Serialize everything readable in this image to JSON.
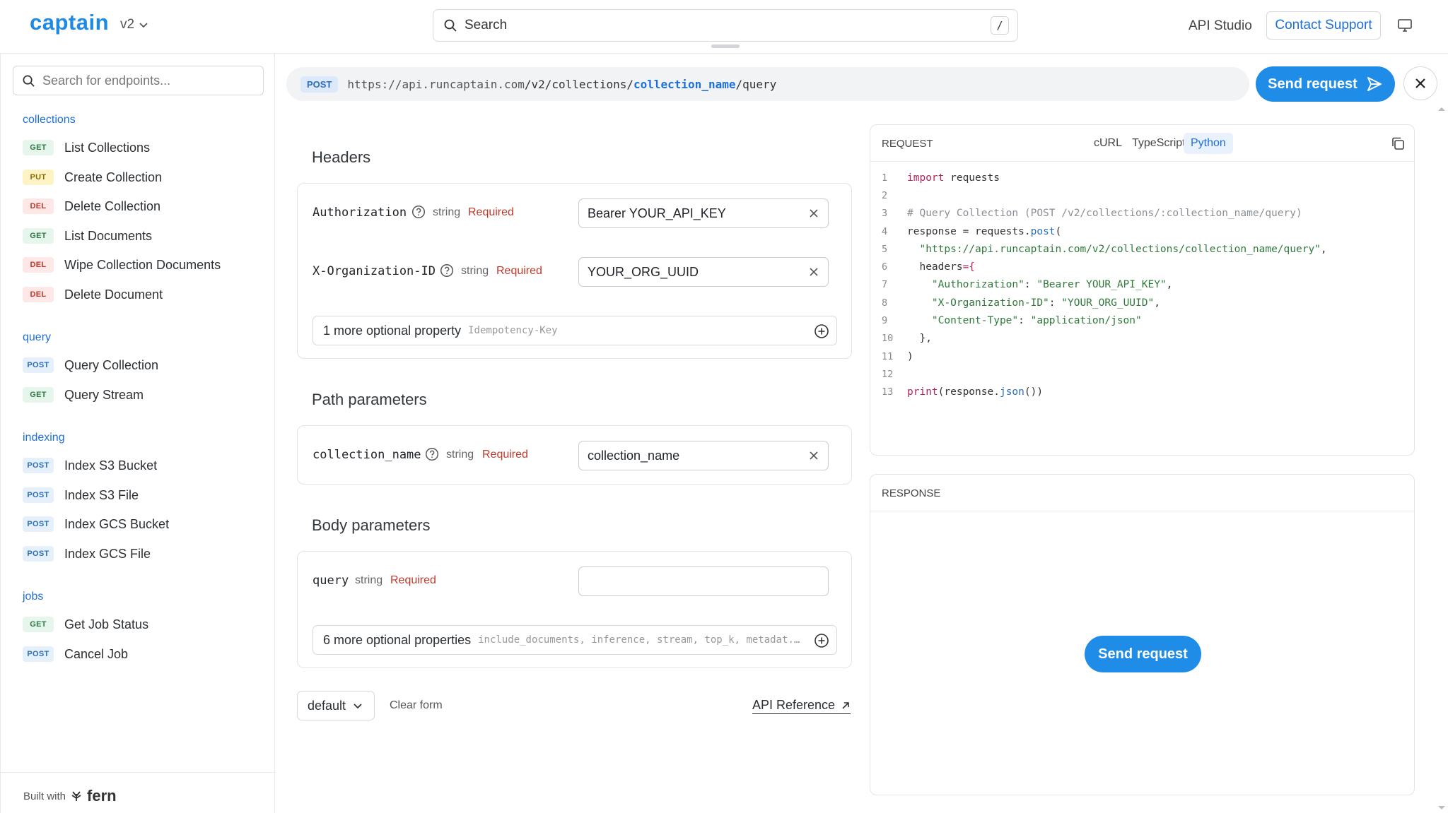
{
  "header": {
    "logo": "captain",
    "version": "v2",
    "search_placeholder": "Search",
    "search_shortcut": "/",
    "api_studio": "API Studio",
    "contact_support": "Contact Support"
  },
  "sidebar": {
    "search_placeholder": "Search for endpoints...",
    "sections": [
      {
        "title": "collections",
        "items": [
          {
            "method": "GET",
            "label": "List Collections"
          },
          {
            "method": "PUT",
            "label": "Create Collection"
          },
          {
            "method": "DEL",
            "label": "Delete Collection"
          },
          {
            "method": "GET",
            "label": "List Documents"
          },
          {
            "method": "DEL",
            "label": "Wipe Collection Documents"
          },
          {
            "method": "DEL",
            "label": "Delete Document"
          }
        ]
      },
      {
        "title": "query",
        "items": [
          {
            "method": "POST",
            "label": "Query Collection"
          },
          {
            "method": "GET",
            "label": "Query Stream"
          }
        ]
      },
      {
        "title": "indexing",
        "items": [
          {
            "method": "POST",
            "label": "Index S3 Bucket"
          },
          {
            "method": "POST",
            "label": "Index S3 File"
          },
          {
            "method": "POST",
            "label": "Index GCS Bucket"
          },
          {
            "method": "POST",
            "label": "Index GCS File"
          }
        ]
      },
      {
        "title": "jobs",
        "items": [
          {
            "method": "GET",
            "label": "Get Job Status"
          },
          {
            "method": "POST",
            "label": "Cancel Job"
          }
        ]
      }
    ],
    "footer_built_with": "Built with",
    "footer_brand": "fern"
  },
  "request_bar": {
    "method": "POST",
    "url_base": "https://api.runcaptain.com",
    "url_path_prefix": "/v2/collections/",
    "url_param": "collection_name",
    "url_path_suffix": "/query",
    "send_label": "Send request"
  },
  "form": {
    "headers_title": "Headers",
    "authorization": {
      "name": "Authorization",
      "type": "string",
      "required": "Required",
      "value": "Bearer YOUR_API_KEY"
    },
    "org_id": {
      "name": "X-Organization-ID",
      "type": "string",
      "required": "Required",
      "value": "YOUR_ORG_UUID"
    },
    "headers_more": {
      "label": "1 more optional property",
      "keys": "Idempotency-Key"
    },
    "path_title": "Path parameters",
    "collection_name": {
      "name": "collection_name",
      "type": "string",
      "required": "Required",
      "value": "collection_name"
    },
    "body_title": "Body parameters",
    "query": {
      "name": "query",
      "type": "string",
      "required": "Required",
      "value": ""
    },
    "body_more": {
      "label": "6 more optional properties",
      "keys": "include_documents, inference, stream, top_k, metadat..."
    },
    "preset": "default",
    "clear_form": "Clear form",
    "api_reference": "API Reference"
  },
  "request_panel": {
    "title": "REQUEST",
    "tabs": [
      "cURL",
      "TypeScript",
      "Python"
    ],
    "active_tab": "Python",
    "code": {
      "l1_kw": "import",
      "l1_rest": " requests",
      "l3": "# Query Collection (POST /v2/collections/:collection_name/query)",
      "l4_a": "response = requests.",
      "l4_fn": "post",
      "l4_b": "(",
      "l5_str": "\"https://api.runcaptain.com/v2/collections/collection_name/query\"",
      "l5_b": ",",
      "l6_a": "headers",
      "l6_b": "={",
      "l7_k": "\"Authorization\"",
      "l7_v": "\"Bearer YOUR_API_KEY\"",
      "l8_k": "\"X-Organization-ID\"",
      "l8_v": "\"YOUR_ORG_UUID\"",
      "l9_k": "\"Content-Type\"",
      "l9_v": "\"application/json\"",
      "l10": "  },",
      "l11": ")",
      "l13_fn": "print",
      "l13_a": "(response.",
      "l13_fn2": "json",
      "l13_b": "())"
    }
  },
  "response_panel": {
    "title": "RESPONSE",
    "send_label": "Send request"
  }
}
